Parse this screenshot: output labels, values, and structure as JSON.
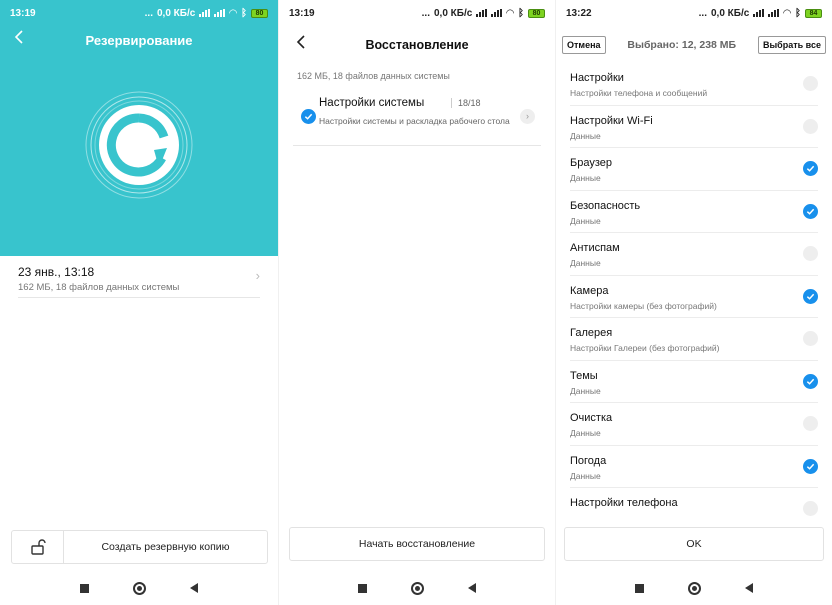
{
  "colors": {
    "accent_teal": "#38c4cd",
    "check_blue": "#1890ec",
    "battery_green": "#7ed321"
  },
  "panel1": {
    "status": {
      "time": "13:19",
      "speed": "0,0 КБ/с",
      "battery": "80"
    },
    "title": "Резервирование",
    "backup": {
      "date": "23 янв., 13:18",
      "details": "162 МБ, 18 файлов данных системы"
    },
    "create_label": "Создать резервную копию",
    "icons": {
      "back": "chevron-left-icon",
      "lock": "unlock-icon",
      "chevron": "chevron-right-icon"
    }
  },
  "panel2": {
    "status": {
      "time": "13:19",
      "speed": "0,0 КБ/с",
      "battery": "80"
    },
    "title": "Восстановление",
    "summary": "162 МБ, 18 файлов данных системы",
    "group": {
      "name": "Настройки системы",
      "count": "18/18",
      "desc": "Настройки системы и раскладка рабочего стола",
      "checked": true
    },
    "start_label": "Начать восстановление"
  },
  "panel3": {
    "status": {
      "time": "13:22",
      "speed": "0,0 КБ/с",
      "battery": "84"
    },
    "cancel_label": "Отмена",
    "selected_text": "Выбрано: 12, 238 МБ",
    "select_all_label": "Выбрать все",
    "items": [
      {
        "name": "Настройки",
        "desc": "Настройки телефона и сообщений",
        "checked": false
      },
      {
        "name": "Настройки Wi-Fi",
        "desc": "Данные",
        "checked": false
      },
      {
        "name": "Браузер",
        "desc": "Данные",
        "checked": true
      },
      {
        "name": "Безопасность",
        "desc": "Данные",
        "checked": true
      },
      {
        "name": "Антиспам",
        "desc": "Данные",
        "checked": false
      },
      {
        "name": "Камера",
        "desc": "Настройки камеры (без фотографий)",
        "checked": true
      },
      {
        "name": "Галерея",
        "desc": "Настройки Галереи (без фотографий)",
        "checked": false
      },
      {
        "name": "Темы",
        "desc": "Данные",
        "checked": true
      },
      {
        "name": "Очистка",
        "desc": "Данные",
        "checked": false
      },
      {
        "name": "Погода",
        "desc": "Данные",
        "checked": true
      },
      {
        "name": "Настройки телефона",
        "desc": "",
        "checked": false
      }
    ],
    "ok_label": "OK"
  }
}
